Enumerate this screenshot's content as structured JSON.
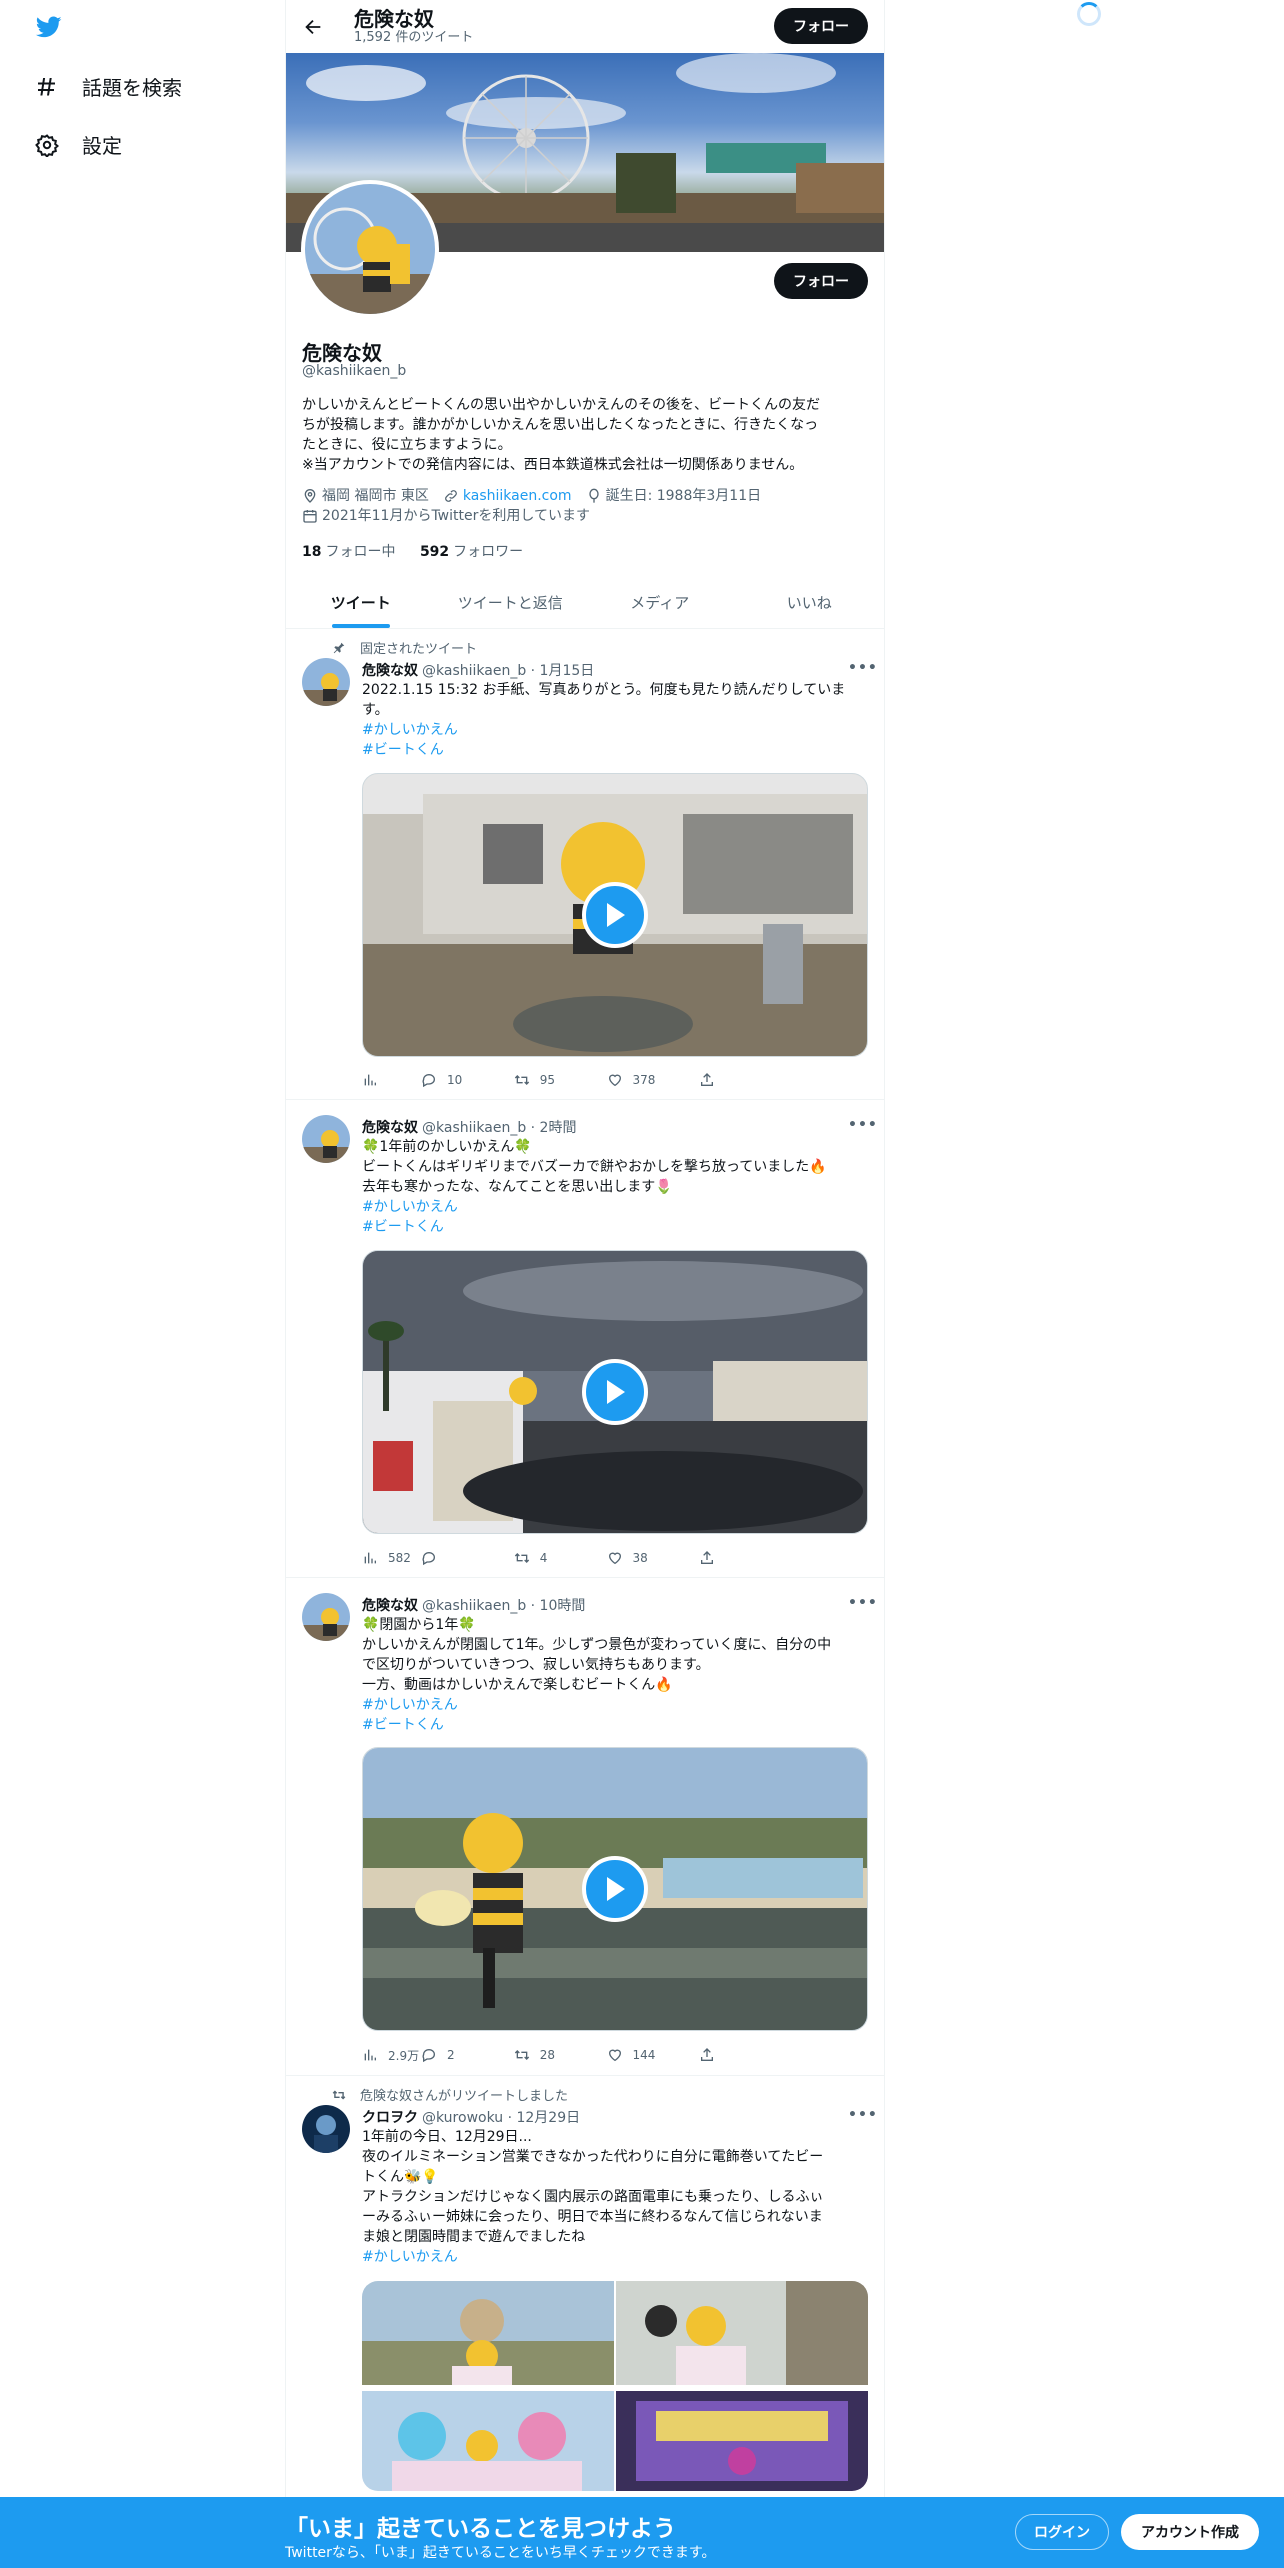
{
  "nav": {
    "explore_label": "話題を検索",
    "settings_label": "設定"
  },
  "header": {
    "title": "危険な奴",
    "tweet_count": "1,592 件のツイート",
    "follow_label": "フォロー"
  },
  "profile": {
    "name": "危険な奴",
    "handle": "@kashiikaen_b",
    "follow_label": "フォロー",
    "bio": [
      "かしいかえんとビートくんの思い出やかしいかえんのその後を、ビートくんの友だ",
      "ちが投稿します。誰かがかしいかえんを思い出したくなったときに、行きたくなっ",
      "たときに、役に立ちますように。",
      "※当アカウントでの発信内容には、西日本鉄道株式会社は一切関係ありません。"
    ],
    "location": "福岡 福岡市 東区",
    "website": "kashiikaen.com",
    "birthday": "誕生日: 1988年3月11日",
    "joined": "2021年11月からTwitterを利用しています",
    "following_count": "18",
    "following_label": "フォロー中",
    "followers_count": "592",
    "followers_label": "フォロワー"
  },
  "tabs": [
    {
      "label": "ツイート",
      "active": true
    },
    {
      "label": "ツイートと返信",
      "active": false
    },
    {
      "label": "メディア",
      "active": false
    },
    {
      "label": "いいね",
      "active": false
    }
  ],
  "tweets": [
    {
      "context": "固定されたツイート",
      "name": "危険な奴",
      "handle_time": "@kashiikaen_b · 1月15日",
      "lines": [
        "2022.1.15 15:32 お手紙、写真ありがとう。何度も見たり読んだりしていま",
        "す。"
      ],
      "tags": [
        "#かしいかえん",
        "#ビートくん"
      ],
      "views": "",
      "replies": "10",
      "retweets": "95",
      "likes": "378"
    },
    {
      "context": "",
      "name": "危険な奴",
      "handle_time": "@kashiikaen_b · 2時間",
      "lines": [
        "🍀1年前のかしいかえん🍀",
        "ビートくんはギリギリまでバズーカで餅やおかしを撃ち放っていました🔥",
        "去年も寒かったな、なんてことを思い出します🌷"
      ],
      "tags": [
        "#かしいかえん",
        "#ビートくん"
      ],
      "views": "582",
      "replies": "",
      "retweets": "4",
      "likes": "38"
    },
    {
      "context": "",
      "name": "危険な奴",
      "handle_time": "@kashiikaen_b · 10時間",
      "lines": [
        "🍀閉園から1年🍀",
        "かしいかえんが閉園して1年。少しずつ景色が変わっていく度に、自分の中",
        "で区切りがついていきつつ、寂しい気持ちもあります。",
        "一方、動画はかしいかえんで楽しむビートくん🔥"
      ],
      "tags": [
        "#かしいかえん",
        "#ビートくん"
      ],
      "views": "2.9万",
      "replies": "2",
      "retweets": "28",
      "likes": "144"
    },
    {
      "context": "危険な奴さんがリツイートしました",
      "name": "クロヲク",
      "handle_time": "@kurowoku · 12月29日",
      "lines": [
        "1年前の今日、12月29日...",
        "夜のイルミネーション営業できなかった代わりに自分に電飾巻いてたビー",
        "トくん🐝💡",
        "アトラクションだけじゃなく園内展示の路面電車にも乗ったり、しるふぃ",
        "ーみるふぃー姉妹に会ったり、明日で本当に終わるなんて信じられないま",
        "ま娘と閉園時間まで遊んでましたね"
      ],
      "tags": [
        "#かしいかえん"
      ]
    }
  ],
  "bottom": {
    "title": "「いま」起きていることを見つけよう",
    "subtitle": "Twitterなら、「いま」起きていることをいち早くチェックできます。",
    "login_label": "ログイン",
    "signup_label": "アカウント作成"
  },
  "colors": {
    "accent": "#1d9bf0",
    "text": "#0f1419",
    "secondary": "#536471"
  }
}
